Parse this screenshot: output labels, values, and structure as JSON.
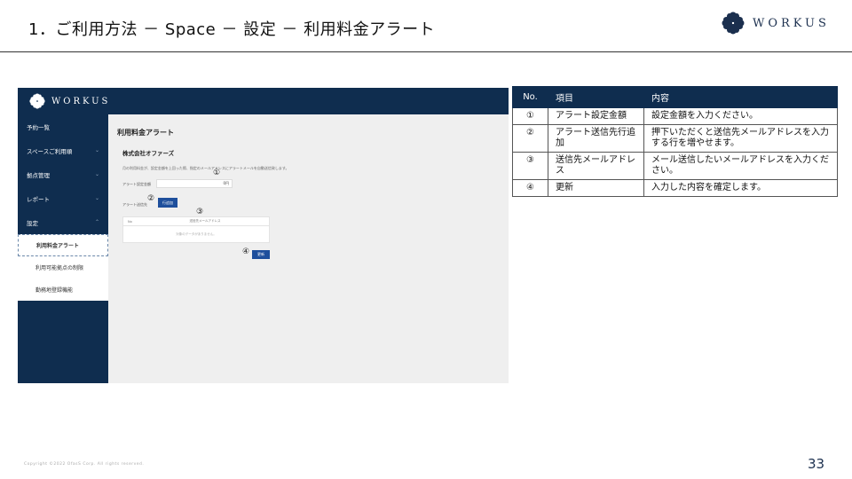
{
  "slide": {
    "title": "1．ご利用方法 － Space － 設定 － 利用料金アラート",
    "brand": "WORKUS",
    "copyright": "Copyright ©2022 OfasS Corp. All rights reserved.",
    "page_number": "33"
  },
  "screenshot": {
    "logo_text": "WORKUS",
    "nav": [
      {
        "label": "予約一覧",
        "chevron": ""
      },
      {
        "label": "スペースご利用順",
        "chevron": "⌄"
      },
      {
        "label": "拠点管理",
        "chevron": "⌄"
      },
      {
        "label": "レポート",
        "chevron": "⌄"
      },
      {
        "label": "設定",
        "chevron": "⌃"
      }
    ],
    "sub_nav": [
      {
        "label": "利用料金アラート",
        "active": true
      },
      {
        "label": "利用可能拠点の制限",
        "active": false
      },
      {
        "label": "勤務地登録機能",
        "active": false
      }
    ],
    "page_title": "利用料金アラート",
    "company": "株式会社オファーズ",
    "description": "月の利用料金が、設定金額を上回った際、指定のメールアドレスにアラートメールを自動送信致します。",
    "amount_label": "アラート設定金額",
    "amount_value": "0円",
    "dest_label": "アラート送信先",
    "add_button": "行追加",
    "table_no": "No",
    "table_col": "送信先メールアドレス",
    "table_empty": "対象のデータがありません。",
    "update_button": "更新",
    "markers": [
      "①",
      "②",
      "③",
      "④"
    ]
  },
  "info_table": {
    "headers": [
      "No.",
      "項目",
      "内容"
    ],
    "rows": [
      {
        "no": "①",
        "item": "アラート設定金額",
        "content": "設定金額を入力ください。"
      },
      {
        "no": "②",
        "item": "アラート送信先行追加",
        "content": "押下いただくと送信先メールアドレスを入力する行を増やせます。"
      },
      {
        "no": "③",
        "item": "送信先メールアドレス",
        "content": "メール送信したいメールアドレスを入力ください。"
      },
      {
        "no": "④",
        "item": "更新",
        "content": "入力した内容を確定します。"
      }
    ]
  }
}
